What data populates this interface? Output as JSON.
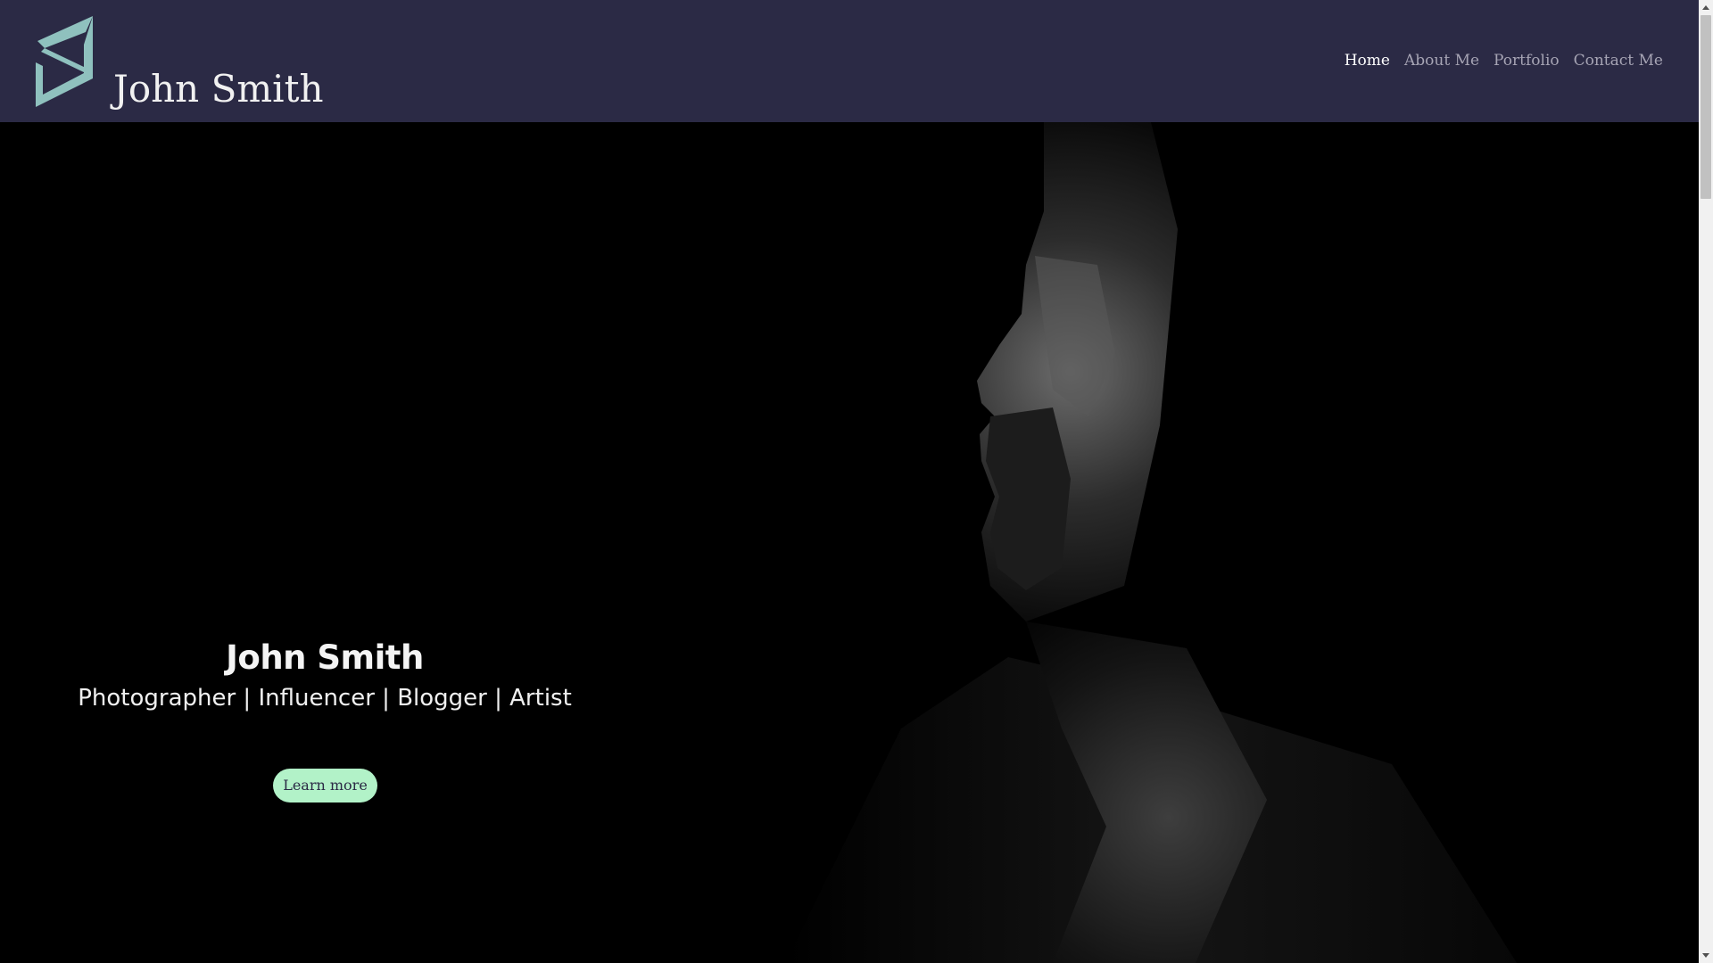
{
  "header": {
    "brand_name": "John Smith",
    "logo_icon": "triangle-s-logo-icon",
    "background_color": "#2b2a45",
    "logo_color": "#8fc1be",
    "nav": [
      {
        "label": "Home",
        "active": true
      },
      {
        "label": "About Me",
        "active": false
      },
      {
        "label": "Portfolio",
        "active": false
      },
      {
        "label": "Contact Me",
        "active": false
      }
    ]
  },
  "hero": {
    "title": "John Smith",
    "subtitle": "Photographer | Influencer | Blogger | Artist",
    "cta_label": "Learn more",
    "cta_color": "#b2f2c8",
    "background_color": "#000000"
  }
}
